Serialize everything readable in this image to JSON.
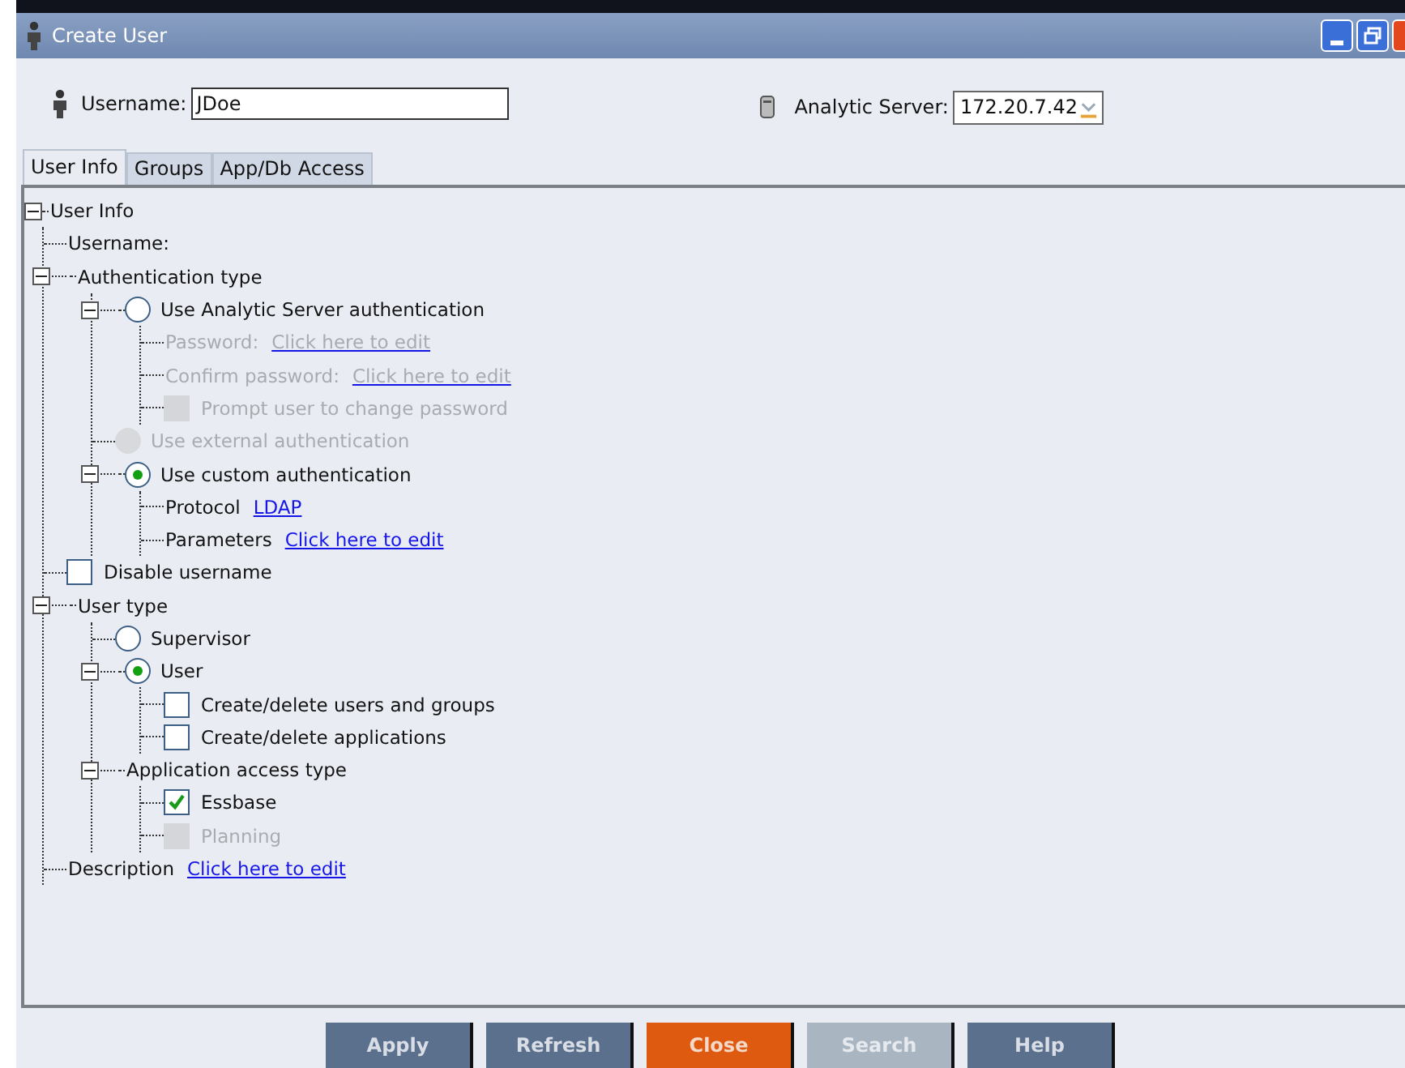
{
  "window": {
    "title": "Create User"
  },
  "header": {
    "username_label": "Username:",
    "username_value": "JDoe",
    "server_label": "Analytic Server:",
    "server_value": "172.20.7.42"
  },
  "tabs": [
    {
      "label": "User Info",
      "selected": true
    },
    {
      "label": "Groups",
      "selected": false
    },
    {
      "label": "App/Db Access",
      "selected": false
    }
  ],
  "tree": {
    "kind": "label",
    "label": "User Info",
    "expanded": true,
    "children": [
      {
        "kind": "label",
        "label": "Username:"
      },
      {
        "kind": "label",
        "label": "Authentication type",
        "expanded": true,
        "children": [
          {
            "kind": "radio",
            "label": "Use Analytic Server authentication",
            "selected": false,
            "disabled": false,
            "expanded": true,
            "children": [
              {
                "kind": "field",
                "label": "Password:",
                "link": "Click here to edit",
                "disabled": true
              },
              {
                "kind": "field",
                "label": "Confirm password:",
                "link": "Click here to edit",
                "disabled": true
              },
              {
                "kind": "checkbox",
                "label": "Prompt user to change password",
                "checked": false,
                "disabled": true
              }
            ]
          },
          {
            "kind": "radio",
            "label": "Use external authentication",
            "selected": false,
            "disabled": true
          },
          {
            "kind": "radio",
            "label": "Use custom authentication",
            "selected": true,
            "disabled": false,
            "expanded": true,
            "children": [
              {
                "kind": "field",
                "label": "Protocol",
                "link": "LDAP",
                "disabled": false
              },
              {
                "kind": "field",
                "label": "Parameters",
                "link": "Click here to edit",
                "disabled": false
              }
            ]
          }
        ]
      },
      {
        "kind": "checkbox",
        "label": "Disable username",
        "checked": false,
        "disabled": false
      },
      {
        "kind": "label",
        "label": "User type",
        "expanded": true,
        "children": [
          {
            "kind": "radio",
            "label": "Supervisor",
            "selected": false,
            "disabled": false
          },
          {
            "kind": "radio",
            "label": "User",
            "selected": true,
            "disabled": false,
            "expanded": true,
            "children": [
              {
                "kind": "checkbox",
                "label": "Create/delete users and groups",
                "checked": false,
                "disabled": false
              },
              {
                "kind": "checkbox",
                "label": "Create/delete applications",
                "checked": false,
                "disabled": false
              }
            ]
          },
          {
            "kind": "label",
            "label": "Application access type",
            "expanded": true,
            "children": [
              {
                "kind": "checkbox",
                "label": "Essbase",
                "checked": true,
                "disabled": false
              },
              {
                "kind": "checkbox",
                "label": "Planning",
                "checked": false,
                "disabled": true
              }
            ]
          }
        ]
      },
      {
        "kind": "field",
        "label": "Description",
        "link": "Click here to edit",
        "disabled": false
      }
    ]
  },
  "buttons": [
    {
      "label": "Apply",
      "kind": "normal",
      "disabled": false
    },
    {
      "label": "Refresh",
      "kind": "normal",
      "disabled": false
    },
    {
      "label": "Close",
      "kind": "primary",
      "disabled": false
    },
    {
      "label": "Search",
      "kind": "normal",
      "disabled": true
    },
    {
      "label": "Help",
      "kind": "normal",
      "disabled": false
    }
  ]
}
